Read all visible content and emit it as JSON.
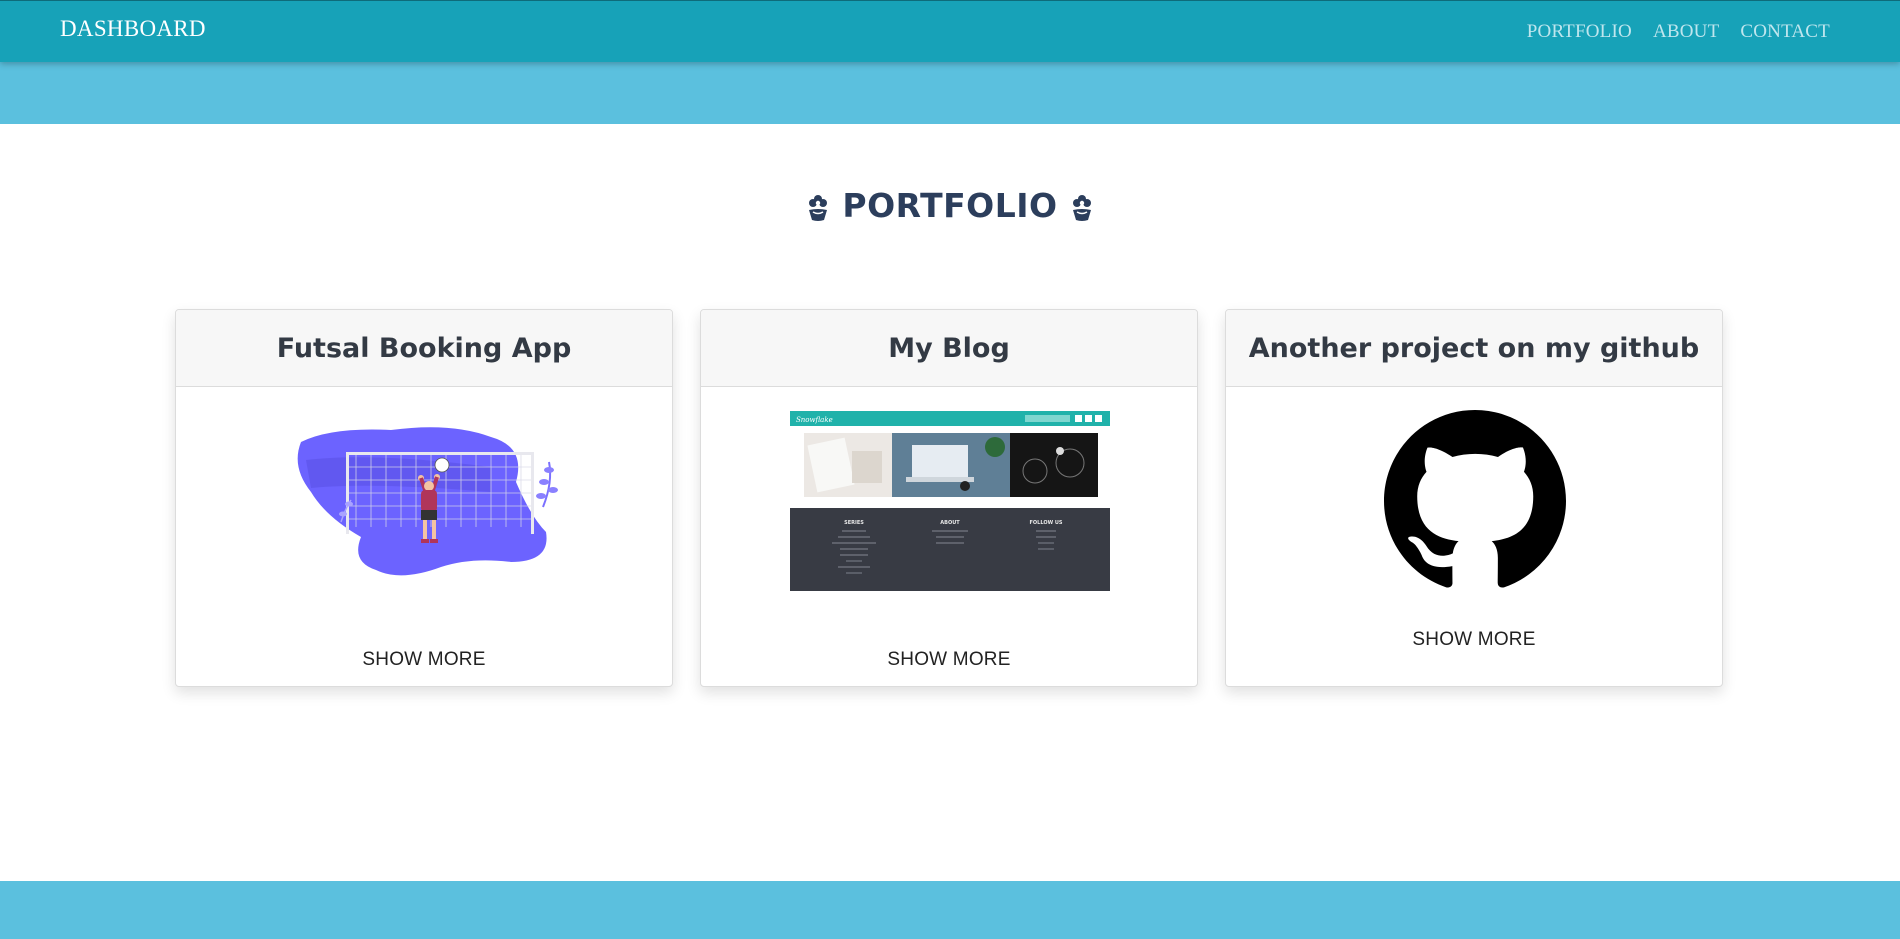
{
  "navbar": {
    "brand": "DASHBOARD",
    "links": [
      "PORTFOLIO",
      "ABOUT",
      "CONTACT"
    ]
  },
  "section": {
    "title": "PORTFOLIO",
    "icon": "flower-icon"
  },
  "cards": [
    {
      "title": "Futsal Booking App",
      "image": "goalkeeper-illustration",
      "action": "SHOW MORE"
    },
    {
      "title": "My Blog",
      "image": "blog-screenshot-thumbnail",
      "action": "SHOW MORE",
      "thumbnail": {
        "logo": "Snowflake",
        "footer_headings": [
          "SERIES",
          "ABOUT",
          "FOLLOW US"
        ]
      }
    },
    {
      "title": "Another project on my github",
      "image": "github-icon",
      "action": "SHOW MORE"
    }
  ],
  "colors": {
    "navbar": "#17a2b8",
    "band": "#5bc0de",
    "title": "#2c3e5c",
    "illustration": "#6c63ff"
  }
}
